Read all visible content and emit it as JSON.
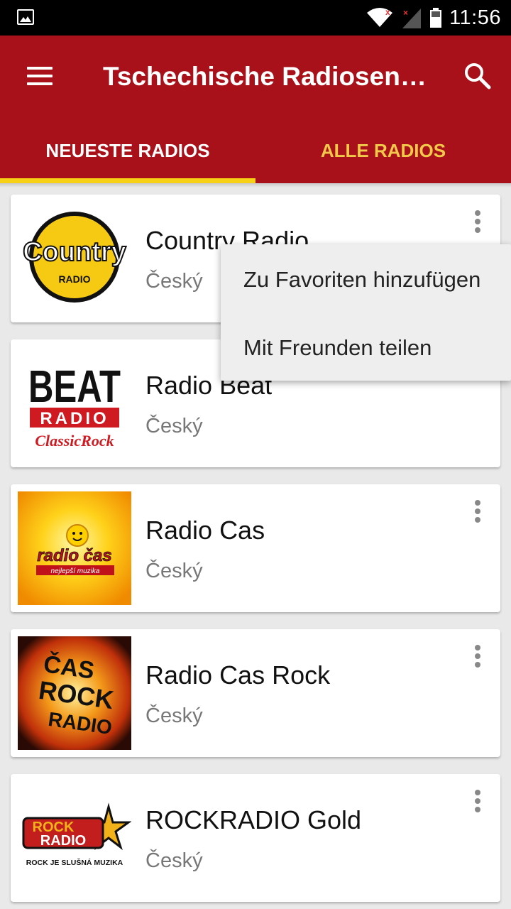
{
  "status_bar": {
    "time": "11:56",
    "icons": [
      "image-notification-icon",
      "wifi-icon",
      "cell-signal-no-data-icon",
      "battery-icon"
    ]
  },
  "app_bar": {
    "title": "Tschechische Radiosender",
    "menu_icon": "hamburger-menu-icon",
    "search_icon": "search-icon",
    "color": "#a8101a"
  },
  "tabs": [
    {
      "label": "NEUESTE RADIOS",
      "active": true
    },
    {
      "label": "ALLE RADIOS",
      "active": false
    }
  ],
  "colors": {
    "accent": "#f7d118",
    "inactive_tab": "#f2c84b"
  },
  "stations": [
    {
      "name": "Country Radio",
      "language": "Český",
      "logo_text": "Country",
      "logo_sub": "RADIO"
    },
    {
      "name": "Radio Beat",
      "language": "Český",
      "logo_text": "BEAT",
      "logo_sub": "RADIO",
      "logo_extra": "ClassicRock"
    },
    {
      "name": "Radio Cas",
      "language": "Český",
      "logo_text": "radio čas",
      "logo_sub": "nejlepší muzika"
    },
    {
      "name": "Radio Cas Rock",
      "language": "Český",
      "logo_text": "ČAS",
      "logo_sub": "ROCK",
      "logo_extra": "RADIO"
    },
    {
      "name": "ROCKRADIO Gold",
      "language": "Český",
      "logo_text": "ROCK",
      "logo_sub": "RADIO",
      "logo_extra": "ROCK JE SLUŠNÁ MUZIKA"
    }
  ],
  "popup_menu": {
    "items": [
      "Zu Favoriten hinzufügen",
      "Mit Freunden teilen"
    ]
  }
}
